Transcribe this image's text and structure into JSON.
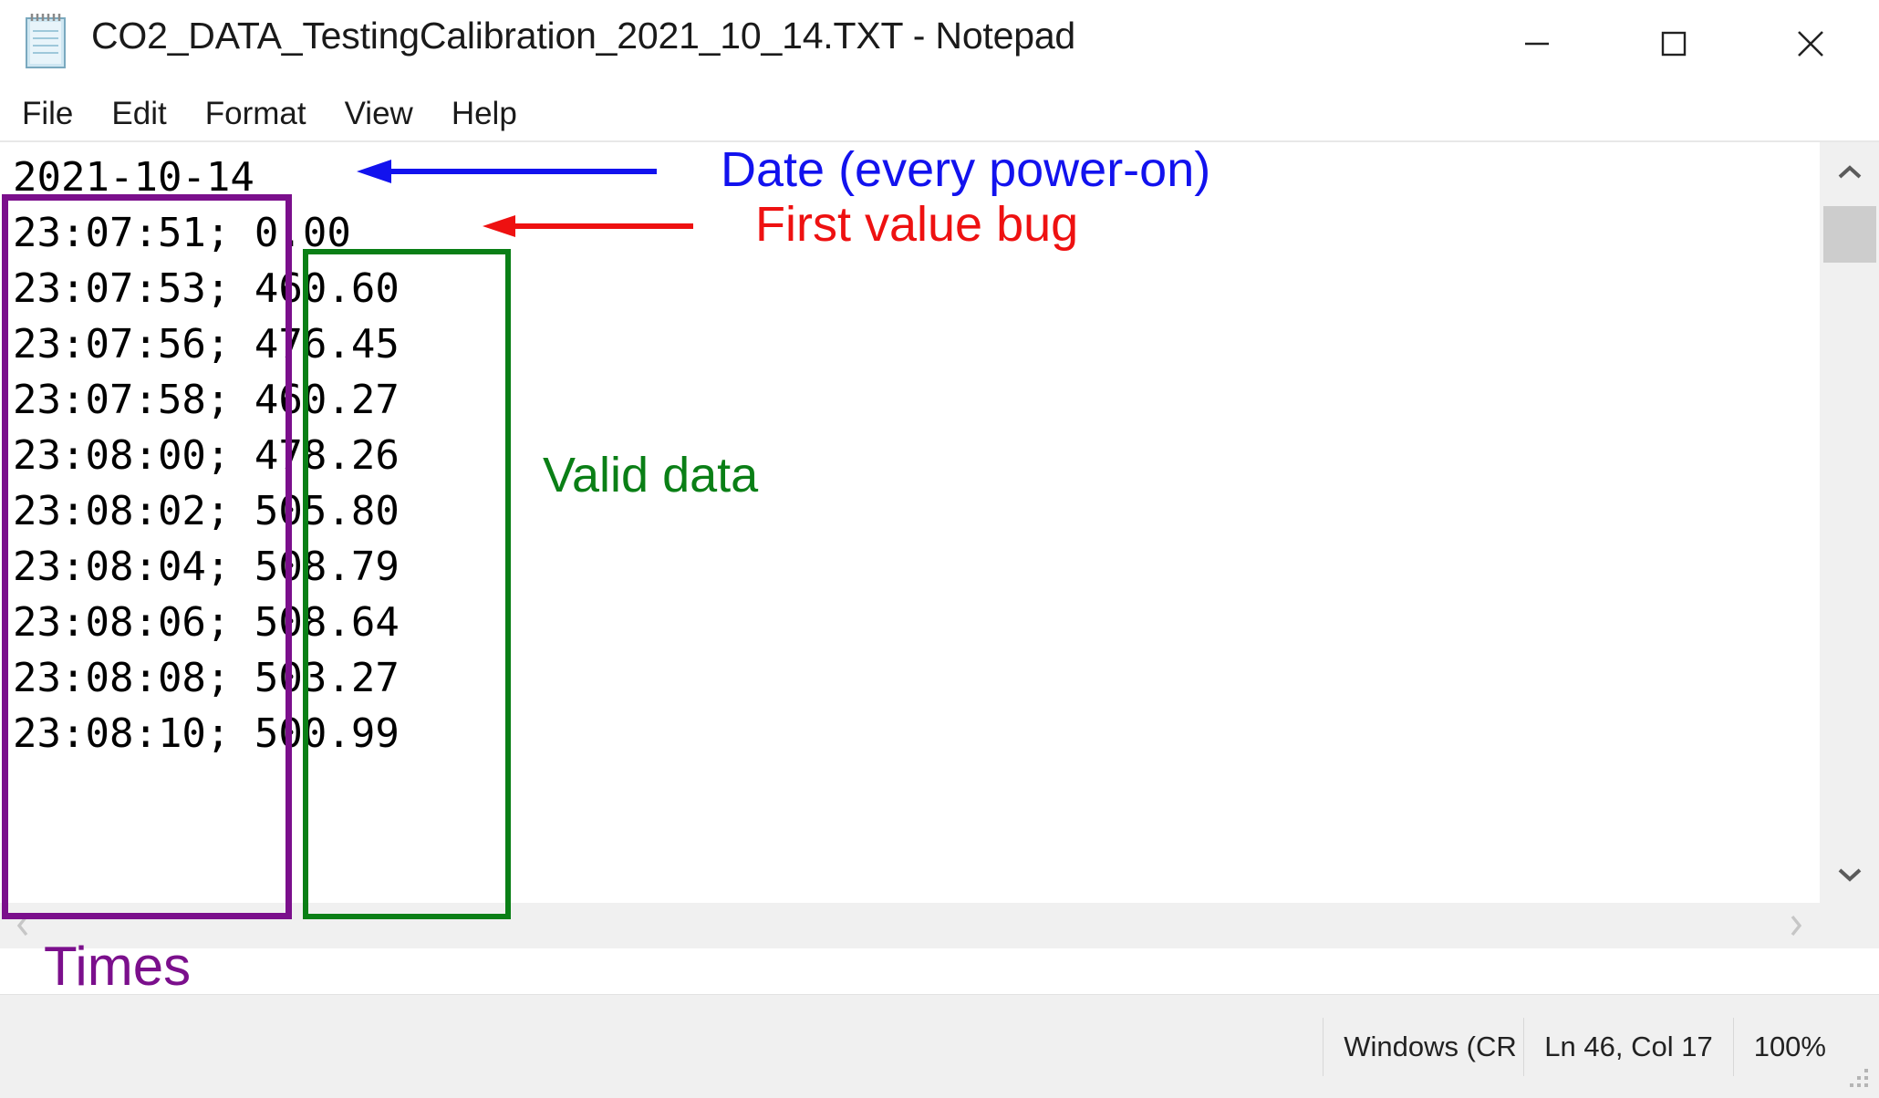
{
  "window": {
    "title": "CO2_DATA_TestingCalibration_2021_10_14.TXT - Notepad",
    "icon": "notepad-icon",
    "minimize_label": "Minimize",
    "maximize_label": "Maximize",
    "close_label": "Close"
  },
  "menu": {
    "items": [
      {
        "label": "File"
      },
      {
        "label": "Edit"
      },
      {
        "label": "Format"
      },
      {
        "label": "View"
      },
      {
        "label": "Help"
      }
    ]
  },
  "document": {
    "header_line": "2021-10-14",
    "rows": [
      {
        "time": "23:07:51;",
        "value": "0.00"
      },
      {
        "time": "23:07:53;",
        "value": "460.60"
      },
      {
        "time": "23:07:56;",
        "value": "476.45"
      },
      {
        "time": "23:07:58;",
        "value": "460.27"
      },
      {
        "time": "23:08:00;",
        "value": "478.26"
      },
      {
        "time": "23:08:02;",
        "value": "505.80"
      },
      {
        "time": "23:08:04;",
        "value": "508.79"
      },
      {
        "time": "23:08:06;",
        "value": "508.64"
      },
      {
        "time": "23:08:08;",
        "value": "503.27"
      },
      {
        "time": "23:08:10;",
        "value": "500.99"
      }
    ],
    "text": "2021-10-14\n23:07:51; 0.00\n23:07:53; 460.60\n23:07:56; 476.45\n23:07:58; 460.27\n23:08:00; 478.26\n23:08:02; 505.80\n23:08:04; 508.79\n23:08:06; 508.64\n23:08:08; 503.27\n23:08:10; 500.99"
  },
  "annotations": {
    "date_note": "Date (every power-on)",
    "first_value_bug": "First value bug",
    "valid_data": "Valid data",
    "times": "Times",
    "colors": {
      "date_note": "#1212ee",
      "first_value_bug": "#ee1111",
      "valid_data": "#0a7f16",
      "times": "#7b0f8c"
    }
  },
  "statusbar": {
    "line_ending": "Windows (CR",
    "cursor": "Ln 46, Col 17",
    "zoom": "100%"
  }
}
